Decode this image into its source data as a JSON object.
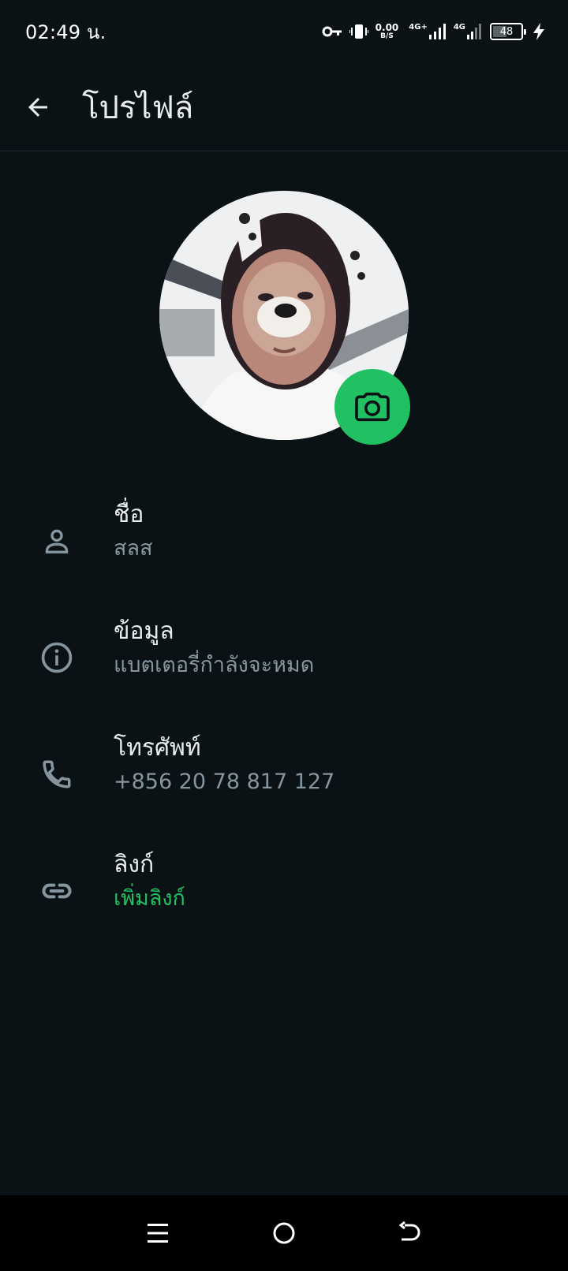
{
  "status_bar": {
    "time": "02:49 น.",
    "net_speed_value": "0.00",
    "net_speed_unit": "B/S",
    "signal1_label": "4G+",
    "signal2_label": "4G",
    "battery_level": "48",
    "icons": [
      "vpn-key-icon",
      "vibrate-icon",
      "signal-icon",
      "battery-icon",
      "charging-icon"
    ]
  },
  "app_bar": {
    "title": "โปรไฟล์"
  },
  "avatar": {
    "camera_icon": "camera-icon",
    "accent_color": "#21c063"
  },
  "info": [
    {
      "icon": "person-icon",
      "label": "ชื่อ",
      "value": "สลส"
    },
    {
      "icon": "info-icon",
      "label": "ข้อมูล",
      "value": "แบตเตอรี่กำลังจะหมด"
    },
    {
      "icon": "phone-icon",
      "label": "โทรศัพท์",
      "value": "+856 20 78 817 127"
    },
    {
      "icon": "link-icon",
      "label": "ลิงก์",
      "value": "เพิ่มลิงก์"
    }
  ],
  "colors": {
    "background": "#0b1215",
    "primary_text": "#e9edef",
    "secondary_text": "#8696a0",
    "accent": "#21c063"
  }
}
